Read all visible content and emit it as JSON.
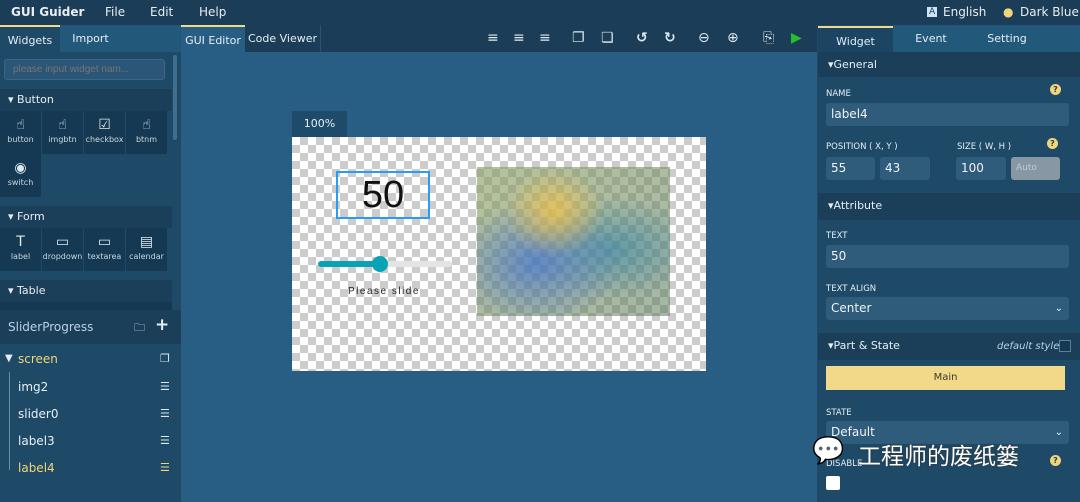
{
  "menu": {
    "app": "GUI Guider",
    "file": "File",
    "edit": "Edit",
    "help": "Help",
    "language": "English",
    "theme": "Dark Blue"
  },
  "left": {
    "tabs": [
      "Widgets",
      "Import"
    ],
    "search_placeholder": "please input widget nam...",
    "sections": [
      {
        "title": "Button",
        "items": [
          "button",
          "imgbtn",
          "checkbox",
          "btnm",
          "switch"
        ]
      },
      {
        "title": "Form",
        "items": [
          "label",
          "dropdown",
          "textarea",
          "calendar"
        ]
      },
      {
        "title": "Table"
      }
    ],
    "project": "SliderProgress",
    "tree": {
      "root": "screen",
      "children": [
        "img2",
        "slider0",
        "label3",
        "label4"
      ]
    }
  },
  "center": {
    "tabs": [
      "GUI Editor",
      "Code Viewer"
    ],
    "zoom": "100%",
    "canvas": {
      "label_text": "50",
      "slider_value_percent": 46,
      "slider_caption": "Please slide"
    }
  },
  "right": {
    "tabs": [
      "Widget",
      "Event",
      "Setting"
    ],
    "general": {
      "title": "General",
      "name_label": "NAME",
      "name": "label4",
      "position_label": "POSITION ( X, Y )",
      "x": "55",
      "y": "43",
      "size_label": "SIZE ( W, H )",
      "w": "100",
      "h_placeholder": "Auto"
    },
    "attribute": {
      "title": "Attribute",
      "text_label": "TEXT",
      "text": "50",
      "align_label": "TEXT ALIGN",
      "align": "Center"
    },
    "part_state": {
      "title": "Part & State",
      "default_style": "default style",
      "part": "Main",
      "state_label": "STATE",
      "state": "Default",
      "disable_label": "DISABLE"
    }
  },
  "watermark": "工程师的废纸篓",
  "colors": {
    "accent": "#f1d98a",
    "selected_tree": "#f2d57a",
    "slider": "#0aa3b5",
    "selection": "#2c9cf0",
    "run": "#22c02a"
  }
}
